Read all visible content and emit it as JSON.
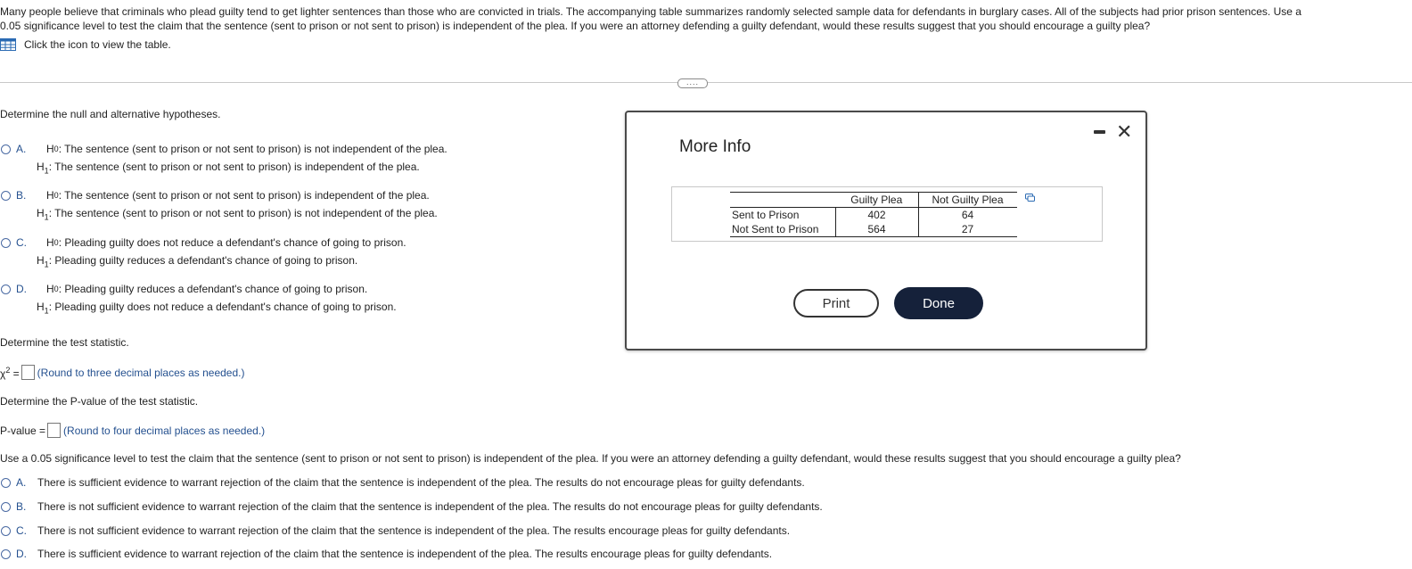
{
  "intro": {
    "line1": "Many people believe that criminals who plead guilty tend to get lighter sentences than those who are convicted in trials. The accompanying table summarizes randomly selected sample data for defendants in burglary cases. All of the subjects had prior prison sentences. Use a",
    "line2": "0.05 significance level to test the claim that the sentence (sent to prison or not sent to prison) is independent of the plea. If you were an attorney defending a guilty defendant, would these results suggest that you should encourage a guilty plea?",
    "table_link": "Click the icon to view the table."
  },
  "ellipsis": "....",
  "q1": {
    "prompt": "Determine the null and alternative hypotheses.",
    "h0_prefix": "H",
    "h0_sub": "0",
    "h1_prefix": "H",
    "h1_sub": "1",
    "options": [
      {
        "letter": "A.",
        "h0": ": The sentence (sent to prison or not sent to prison) is not independent of the plea.",
        "h1": ": The sentence (sent to prison or not sent to prison) is independent of the plea."
      },
      {
        "letter": "B.",
        "h0": ": The sentence (sent to prison or not sent to prison) is independent of the plea.",
        "h1": ": The sentence (sent to prison or not sent to prison) is not independent of the plea."
      },
      {
        "letter": "C.",
        "h0": ": Pleading guilty does not reduce a defendant's chance of going to prison.",
        "h1": ": Pleading guilty reduces a defendant's chance of going to prison."
      },
      {
        "letter": "D.",
        "h0": ": Pleading guilty reduces a defendant's chance of going to prison.",
        "h1": ": Pleading guilty does not reduce a defendant's chance of going to prison."
      }
    ]
  },
  "q2": {
    "prompt": "Determine the test statistic.",
    "symbol": "χ",
    "sup": "2",
    "equals": " =",
    "value": "",
    "hint": "(Round to three decimal places as needed.)"
  },
  "q3": {
    "prompt": "Determine the P-value of the test statistic.",
    "label": "P-value =",
    "value": "",
    "hint": "(Round to four decimal places as needed.)"
  },
  "q4": {
    "prompt": "Use a 0.05 significance level to test the claim that the sentence (sent to prison or not sent to prison) is independent of the plea. If you were an attorney defending a guilty defendant, would these results suggest that you should encourage a guilty plea?",
    "options": [
      {
        "letter": "A.",
        "text": "There is sufficient evidence to warrant rejection of the claim that the sentence is independent of the plea. The results do not encourage pleas for guilty defendants."
      },
      {
        "letter": "B.",
        "text": "There is not sufficient evidence to warrant rejection of the claim that the sentence is independent of the plea. The results do not encourage pleas for guilty defendants."
      },
      {
        "letter": "C.",
        "text": "There is not sufficient evidence to warrant rejection of the claim that the sentence is independent of the plea. The results encourage pleas for guilty defendants."
      },
      {
        "letter": "D.",
        "text": "There is sufficient evidence to warrant rejection of the claim that the sentence is independent of the plea. The results encourage pleas for guilty defendants."
      }
    ]
  },
  "dialog": {
    "title": "More Info",
    "close_glyph": "✕",
    "print_label": "Print",
    "done_label": "Done",
    "table": {
      "columns": [
        "Guilty Plea",
        "Not Guilty Plea"
      ],
      "rows": [
        {
          "label": "Sent to Prison",
          "values": [
            "402",
            "64"
          ]
        },
        {
          "label": "Not Sent to Prison",
          "values": [
            "564",
            "27"
          ]
        }
      ]
    }
  },
  "colors": {
    "accent": "#24508f",
    "done_button": "#15213a",
    "table_icon": "#2a6ab3"
  }
}
